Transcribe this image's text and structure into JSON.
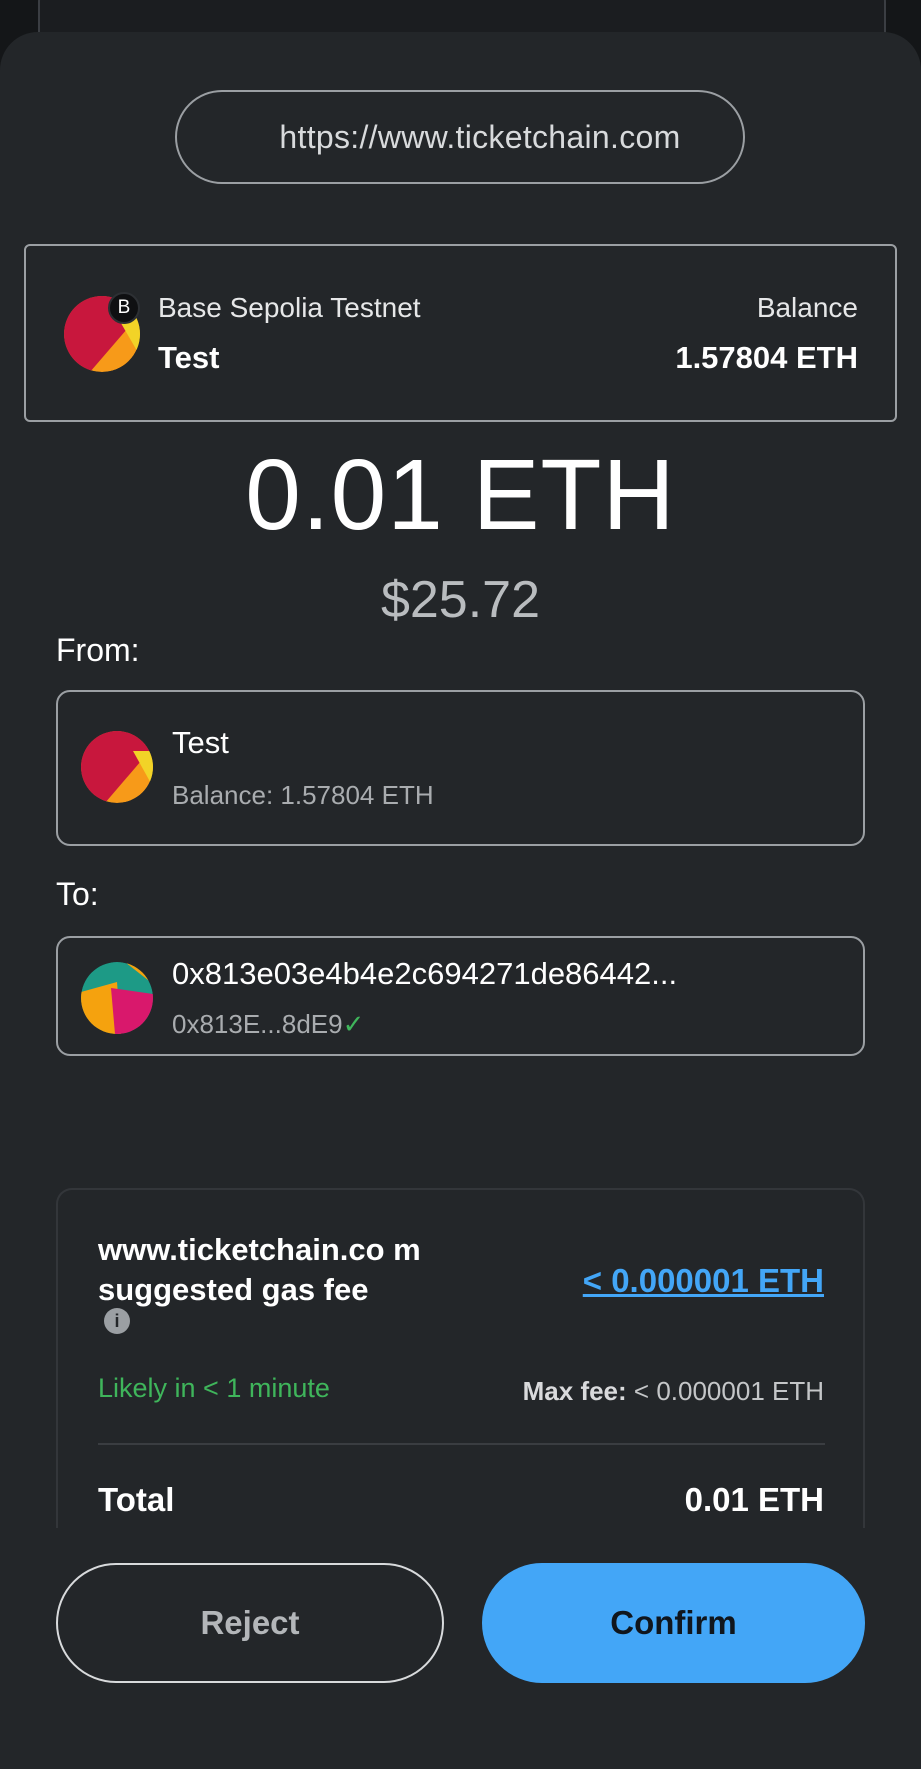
{
  "origin": {
    "url": "https://www.ticketchain.com"
  },
  "account_card": {
    "network_badge": "B",
    "network_name": "Base Sepolia Testnet",
    "account_name": "Test",
    "balance_label": "Balance",
    "balance_value": "1.57804 ETH"
  },
  "transaction": {
    "amount": "0.01 ETH",
    "fiat": "$25.72"
  },
  "from": {
    "label": "From:",
    "name": "Test",
    "balance": "Balance: 1.57804 ETH"
  },
  "to": {
    "label": "To:",
    "address": "0x813e03e4b4e2c694271de86442...",
    "short_address": "0x813E...8dE9",
    "verified_mark": "✓"
  },
  "fee": {
    "title": "www.ticketchain.co m suggested gas fee",
    "info_icon": "i",
    "amount_link": "< 0.000001 ETH",
    "likely": "Likely in < 1 minute",
    "max_fee_label": "Max fee:",
    "max_fee_value": "< 0.000001 ETH",
    "total_label": "Total",
    "total_value": "0.01 ETH"
  },
  "actions": {
    "reject": "Reject",
    "confirm": "Confirm"
  },
  "colors": {
    "accent": "#43a6f7",
    "success": "#3fb55b",
    "background": "#232629"
  }
}
